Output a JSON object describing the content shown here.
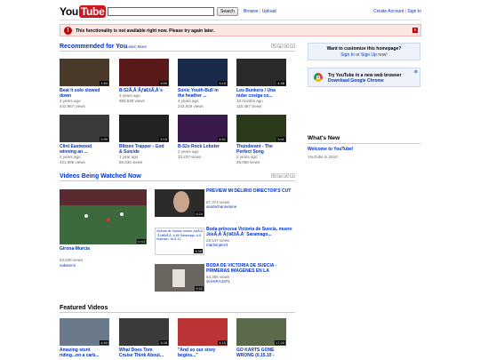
{
  "header": {
    "logo_you": "You",
    "logo_tube": "Tube",
    "search_button": "Search",
    "links": [
      "Browse",
      "Upload"
    ],
    "right_links": [
      "Create Account",
      "Sign In"
    ]
  },
  "alert": {
    "text": "This functionality is not available right now. Please try again later.",
    "close": "x"
  },
  "recommended": {
    "title": "Recommended for You",
    "learn_more": "Learn More",
    "videos": [
      {
        "title": "Beat it solo slowed down",
        "age": "3 years ago",
        "views": "442,967 views",
        "duration": "1:54"
      },
      {
        "title": "B-52Ã‚Â´Ãƒâ€šÃ‚Â´s",
        "age": "3 years ago",
        "views": "993,539 views",
        "duration": "3:59"
      },
      {
        "title": "Sonic Youth-Bull in the heather ...",
        "age": "4 years ago",
        "views": "242,919 views",
        "duration": "3:15"
      },
      {
        "title": "Los Bunkers / Una nube cosiga co...",
        "age": "10 months ago",
        "views": "115,487 views",
        "duration": "4:38"
      },
      {
        "title": "Clint Eastwood winning an ...",
        "age": "2 years ago",
        "views": "421,595 views",
        "duration": "2:59"
      },
      {
        "title": "Blitzen Trapper - God & Suicide",
        "age": "1 year ago",
        "views": "56,536 views",
        "duration": "3:15"
      },
      {
        "title": "B-52s Rock Lobster",
        "age": "2 years ago",
        "views": "33,237 views",
        "duration": "4:52"
      },
      {
        "title": "Thunderant - The Perfect Song",
        "age": "2 years ago",
        "views": "25,065 views",
        "duration": "3:41"
      }
    ]
  },
  "watched_now": {
    "title": "Being Watched Now",
    "main": {
      "title": "Girona-Murcia",
      "views": "63,836 views",
      "user": "sakatomi",
      "duration": "0:43"
    },
    "list": [
      {
        "title": "PREVIEW MI DELIRIO DIRECTOR'S CUT",
        "views": "67,374 views",
        "user": "anahichannelone",
        "duration": "0:24"
      },
      {
        "title": "Boda princesa Victoria de Suecia, muere JosÃ‚Â´Ãƒâ€šÃ‚Â´ Saramago...",
        "views": "28,547 views",
        "user": "marlolopez4",
        "duration": "3:38"
      },
      {
        "title": "BODA DE VICTORIA DE SUECIA - PRIMERAS IMAGENES EN LA",
        "views": "64,356 views",
        "user": "SAHIRA1971",
        "duration": "9:52"
      }
    ],
    "thumb_caption": "Victoria de Suecia, muere JosÃ‚Â´Ãƒâ€šÃ‚Â´ A-60 Saramago, A-8 Noticias / 16-6-10"
  },
  "featured": {
    "title": "Featured Videos",
    "videos": [
      {
        "title": "Amazing stunt riding...on a carb...",
        "duration": "4:50"
      },
      {
        "title": "What Does Tom Cruise Think About...",
        "duration": "3:28"
      },
      {
        "title": "\"And so our story begins...\"",
        "duration": "4:15"
      },
      {
        "title": "GO KARTS GONE WRONG (0.15.10 -",
        "duration": "17:20"
      }
    ]
  },
  "sidebar": {
    "customize_text": "Want to customize this homepage?",
    "sign_in": "Sign In",
    "or": "or",
    "sign_up": "Sign Up",
    "now": "now!",
    "chrome_text": "Try YouTube in a new web browser",
    "chrome_link": "Download Google Chrome",
    "whats_new": "What's New",
    "welcome_link": "Welcome to YouTube!",
    "welcome_sub": "YouTube in 2010"
  },
  "colors": {
    "brand_red": "#cc181e",
    "link_blue": "#0033cc",
    "alert_bg": "#fde7e5"
  }
}
